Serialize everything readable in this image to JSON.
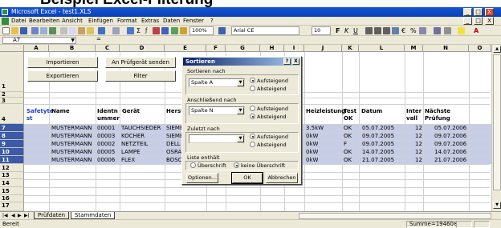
{
  "page_heading": "Beispiel Excel-Filterung",
  "window": {
    "title": "Microsoft Excel - test1.XLS",
    "controls": [
      "_",
      "□",
      "X"
    ],
    "doc_controls": [
      "_",
      "□",
      "X"
    ]
  },
  "menu": [
    "Datei",
    "Bearbeiten",
    "Ansicht",
    "Einfügen",
    "Format",
    "Extras",
    "Daten",
    "Fenster",
    "?"
  ],
  "toolbar": {
    "zoom": "100%",
    "font": "Arial CE",
    "size": "10",
    "bold": "F",
    "italic": "K",
    "underline": "U"
  },
  "formula_bar": {
    "name_box": "A7",
    "equals": "="
  },
  "columns": [
    "A",
    "B",
    "C",
    "D",
    "E",
    "F",
    "G",
    "H",
    "I",
    "J",
    "K",
    "L",
    "M",
    "N",
    "O"
  ],
  "rows": [
    "1",
    "2",
    "3",
    "4",
    "5",
    "6",
    "7",
    "8",
    "9",
    "10",
    "11",
    "12",
    "13",
    "14",
    "15",
    "16",
    "17"
  ],
  "sheet_buttons": {
    "import": "Importieren",
    "export": "Exportieren",
    "sort_by_inspector": "An Prüfgerät senden",
    "filter": "Filter"
  },
  "table_headers": {
    "a": [
      "Safetyte",
      "st"
    ],
    "b": "Name",
    "c": [
      "Identn",
      "ummer"
    ],
    "d": "Gerät",
    "e": "Herst",
    "j": "Heizleistung",
    "k": [
      "Test",
      "OK"
    ],
    "l": "Datum",
    "m": [
      "Inter",
      "vall"
    ],
    "n": [
      "Nächste",
      "Prüfung"
    ]
  },
  "table_rows": [
    {
      "b": "MUSTERMANN",
      "c": "00001",
      "d": "TAUCHSIEDER",
      "e": "SIEME",
      "j": "3.5kW",
      "k": "OK",
      "l": "05.07.2005",
      "m": "12",
      "n": "05.07.2006"
    },
    {
      "b": "MUSTERMANN",
      "c": "00003",
      "d": "KOCHER",
      "e": "SIEME",
      "j": "0kW",
      "k": "OK",
      "l": "09.07.2005",
      "m": "12",
      "n": "09.07.2006"
    },
    {
      "b": "MUSTERMANN",
      "c": "00002",
      "d": "NETZTEIL",
      "e": "DELL",
      "j": "0kW",
      "k": "F",
      "l": "09.07.2005",
      "m": "12",
      "n": "09.07.2006"
    },
    {
      "b": "MUSTERMANN",
      "c": "00005",
      "d": "LAMPE",
      "e": "OSRA",
      "j": "0kW",
      "k": "OK",
      "l": "14.07.2005",
      "m": "12",
      "n": "14.07.2006"
    },
    {
      "b": "MUSTERMANN",
      "c": "00006",
      "d": "FLEX",
      "e": "BOSC",
      "j": "0kW",
      "k": "OK",
      "l": "21.07.2005",
      "m": "12",
      "n": "21.07.2006"
    }
  ],
  "sheet_tabs": [
    "Prüfdaten",
    "Stammdaten"
  ],
  "status": {
    "ready": "Bereit",
    "sum": "Summe=194608"
  },
  "sort_dialog": {
    "title": "Sortieren",
    "help": "?",
    "close": "X",
    "sort_by_label": "Sortieren nach",
    "sort_by_value": "Spalte A",
    "then_by_label": "Anschließend nach",
    "then_by_value": "Spalte N",
    "finally_by_label": "Zuletzt nach",
    "finally_by_value": "",
    "ascending": "Aufsteigend",
    "descending": "Absteigend",
    "list_contains_label": "Liste enthält",
    "header_option": "Überschrift",
    "no_header_option": "keine Überschrift",
    "options_button": "Optionen...",
    "ok_button": "OK",
    "cancel_button": "Abbrechen"
  }
}
